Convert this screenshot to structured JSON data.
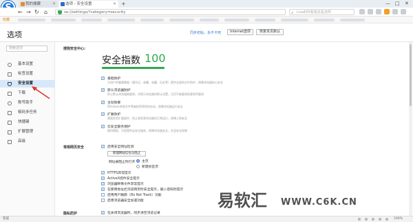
{
  "browser": {
    "tabs": [
      {
        "label": "我的搜藏"
      },
      {
        "label": "选项 - 安全设置"
      }
    ],
    "new_tab_symbol": "+",
    "address": "se://settings/?category=security",
    "search_placeholder": "Lisa的你看看这是怎样",
    "favorites_label": "收藏",
    "window_controls": [
      "—",
      "□",
      "✕"
    ]
  },
  "header": {
    "title": "选项",
    "link": "同步初始，永不卡死",
    "buttons": [
      "Internet选项",
      "恢复本页默认"
    ]
  },
  "sidebar": {
    "search_placeholder": "搜索选项",
    "items": [
      {
        "label": "基本设置",
        "icon": "gear-icon"
      },
      {
        "label": "标签设置",
        "icon": "tab-icon"
      },
      {
        "label": "安全设置",
        "icon": "shield-icon",
        "active": true
      },
      {
        "label": "下载",
        "icon": "download-icon"
      },
      {
        "label": "账号助手",
        "icon": "user-icon"
      },
      {
        "label": "极码多任务",
        "icon": "grid-icon"
      },
      {
        "label": "快捷键",
        "icon": "keyboard-icon"
      },
      {
        "label": "扩展管理",
        "icon": "puzzle-icon"
      },
      {
        "label": "高级",
        "icon": "advanced-icon"
      }
    ]
  },
  "security": {
    "section_label": "搜狗安全中心:",
    "score_title": "安全指数",
    "score_value": "100",
    "score_fraction": 1.0,
    "options": [
      {
        "title": "基础防护",
        "desc": "为用户的重要数据（通讯记、收藏、收藏、历史等）提供全面的文件防护，保障浏览器核心安全"
      },
      {
        "title": "默认浏览器防护",
        "desc": "防止默认浏览器被篡改，并提示浏览器的默认设置，主页不被篡改恶意程序篡改"
      },
      {
        "title": "主动防御",
        "desc": "Windows系统文件等被程序停用时启动，保障浏览器运行安全"
      },
      {
        "title": "扩展防护",
        "desc": "隔离危险扩展插件，防止其危害浏览器的正常运行，保障上网安全"
      },
      {
        "title": "云安全服务保护",
        "desc": "随时随地，为您提供云安全服务，保障浏览器安全，社会安全保障"
      }
    ]
  },
  "web_security": {
    "section_label": "常规网页安全",
    "options": [
      {
        "title": "启用安全网址检测",
        "checked": true
      },
      {
        "title": "HTTPS异常提示",
        "checked": true
      },
      {
        "title": "ActiveX控件安全提示",
        "checked": true
      },
      {
        "title": "浏览器映像文件异常提示",
        "checked": true
      },
      {
        "title": "在使用地址栏浏览网页时安全提示，输入密码时提示",
        "checked": true
      },
      {
        "title": "启用用户跟踪（Do Not Track）功能",
        "checked": false
      },
      {
        "title": "启用浏览器安全加速功能",
        "checked": false
      }
    ],
    "button": "管理网站信任与阻止",
    "radio_group_label": "网址被阻止时打开",
    "radio_options": [
      {
        "label": "主页",
        "checked": true
      },
      {
        "label": "新建标签页",
        "checked": false
      }
    ]
  },
  "privacy": {
    "section_label": "隐私防护",
    "first_option": "在关闭浏览器时，同步清空浏览记录"
  },
  "watermark": {
    "cn": "易软汇",
    "url": "WWW.C6K.CN"
  },
  "statusbar": {
    "left": "完成",
    "right": "100%"
  },
  "colors": {
    "accent": "#2c6fc9",
    "score_green": "#2fa84f",
    "active_item_bg": "#d8e8fb",
    "arrow_red": "#e0302a"
  }
}
